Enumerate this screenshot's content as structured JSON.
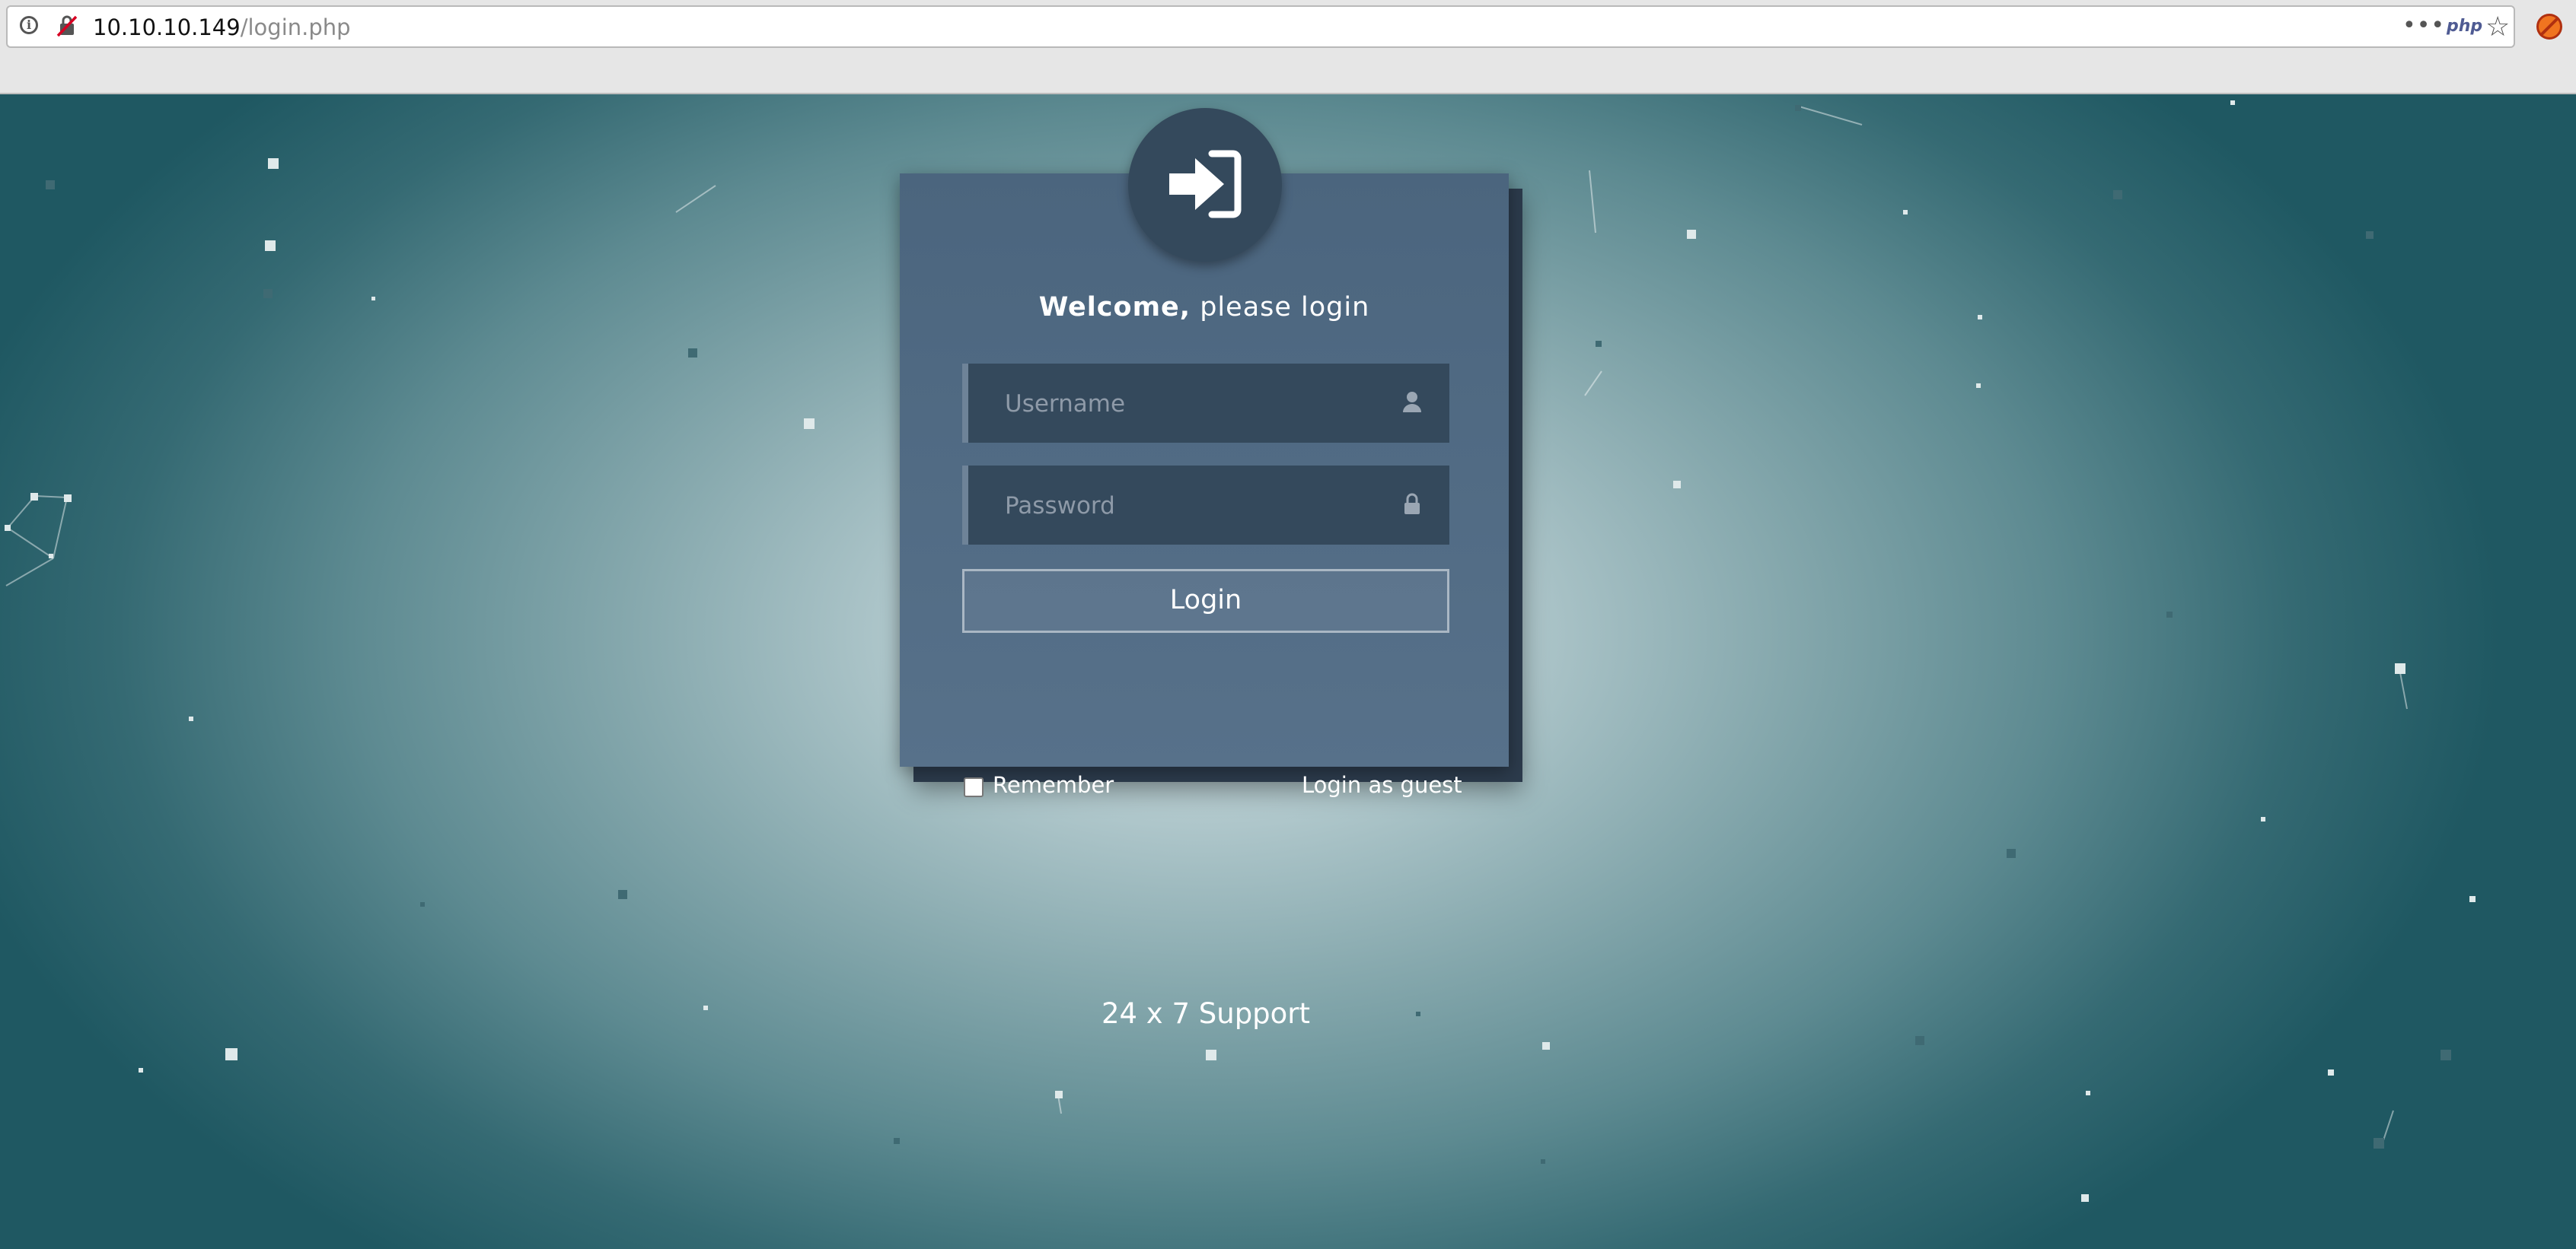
{
  "browser": {
    "url_host": "10.10.10.149",
    "url_path": "/login.php",
    "more_label": "•••",
    "php_badge": "php",
    "star_glyph": "☆",
    "icons": [
      "info-icon",
      "insecure-connection-icon",
      "more-actions-icon",
      "php-addon-icon",
      "bookmark-star-icon",
      "addon-blocked-icon"
    ]
  },
  "login": {
    "welcome_bold": "Welcome,",
    "welcome_rest": " please login",
    "username_placeholder": "Username",
    "password_placeholder": "Password",
    "login_button": "Login",
    "remember_label": "Remember",
    "guest_link": "Login as guest",
    "icon": "sign-in-icon"
  },
  "footer": {
    "support_text": "24 x 7 Support"
  },
  "colors": {
    "card": "#4b657e",
    "field": "#34495c",
    "circle": "#34495c",
    "background_center": "#d7e4e6",
    "background_edge": "#1f5862"
  }
}
